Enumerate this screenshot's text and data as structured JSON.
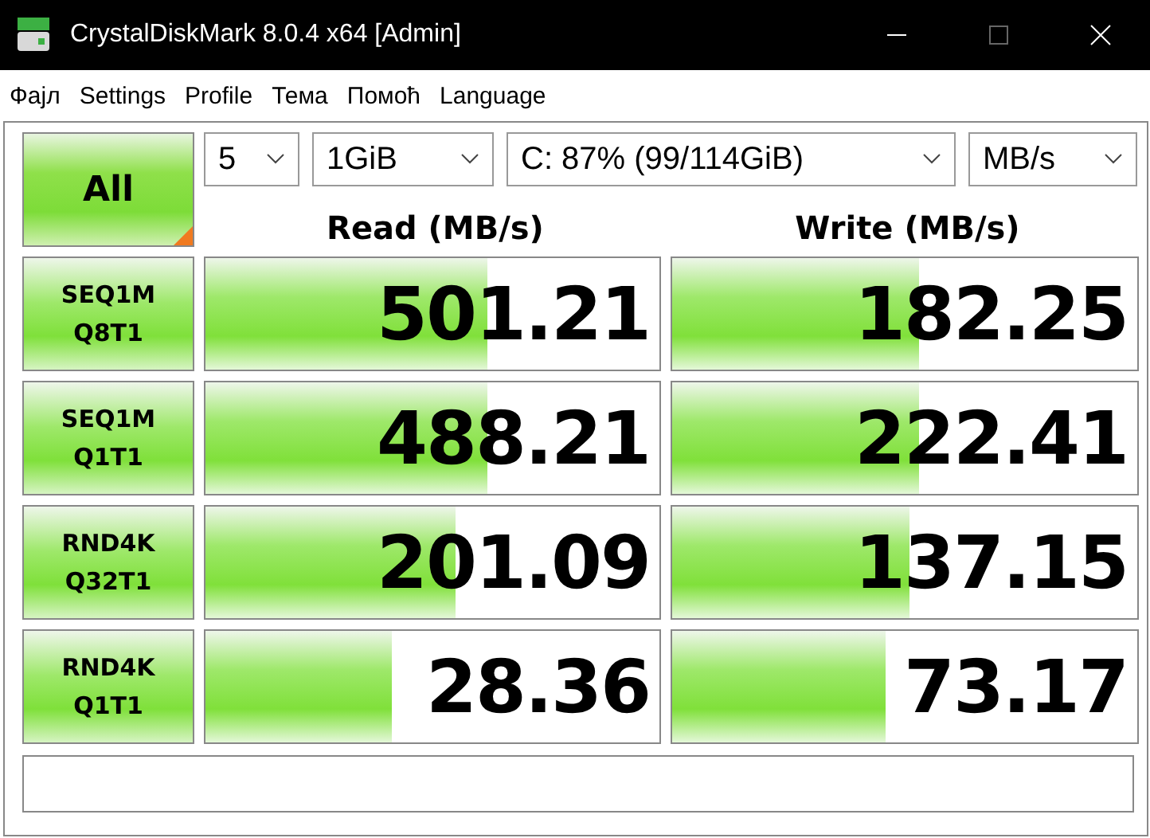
{
  "window": {
    "title": "CrystalDiskMark 8.0.4 x64 [Admin]"
  },
  "menu": [
    "Фајл",
    "Settings",
    "Profile",
    "Тема",
    "Помоћ",
    "Language"
  ],
  "all_button": {
    "label": "All"
  },
  "selects": [
    {
      "value": "5"
    },
    {
      "value": "1GiB"
    },
    {
      "value": "C: 87% (99/114GiB)"
    },
    {
      "value": "MB/s"
    }
  ],
  "columns": [
    "Read (MB/s)",
    "Write (MB/s)"
  ],
  "rows": [
    {
      "line1": "SEQ1M",
      "line2": "Q8T1",
      "read": {
        "value": "501.21",
        "level": 0.62
      },
      "write": {
        "value": "182.25",
        "level": 0.53
      }
    },
    {
      "line1": "SEQ1M",
      "line2": "Q1T1",
      "read": {
        "value": "488.21",
        "level": 0.62
      },
      "write": {
        "value": "222.41",
        "level": 0.53
      }
    },
    {
      "line1": "RND4K",
      "line2": "Q32T1",
      "read": {
        "value": "201.09",
        "level": 0.55
      },
      "write": {
        "value": "137.15",
        "level": 0.51
      }
    },
    {
      "line1": "RND4K",
      "line2": "Q1T1",
      "read": {
        "value": "28.36",
        "level": 0.41
      },
      "write": {
        "value": "73.17",
        "level": 0.46
      }
    }
  ]
}
